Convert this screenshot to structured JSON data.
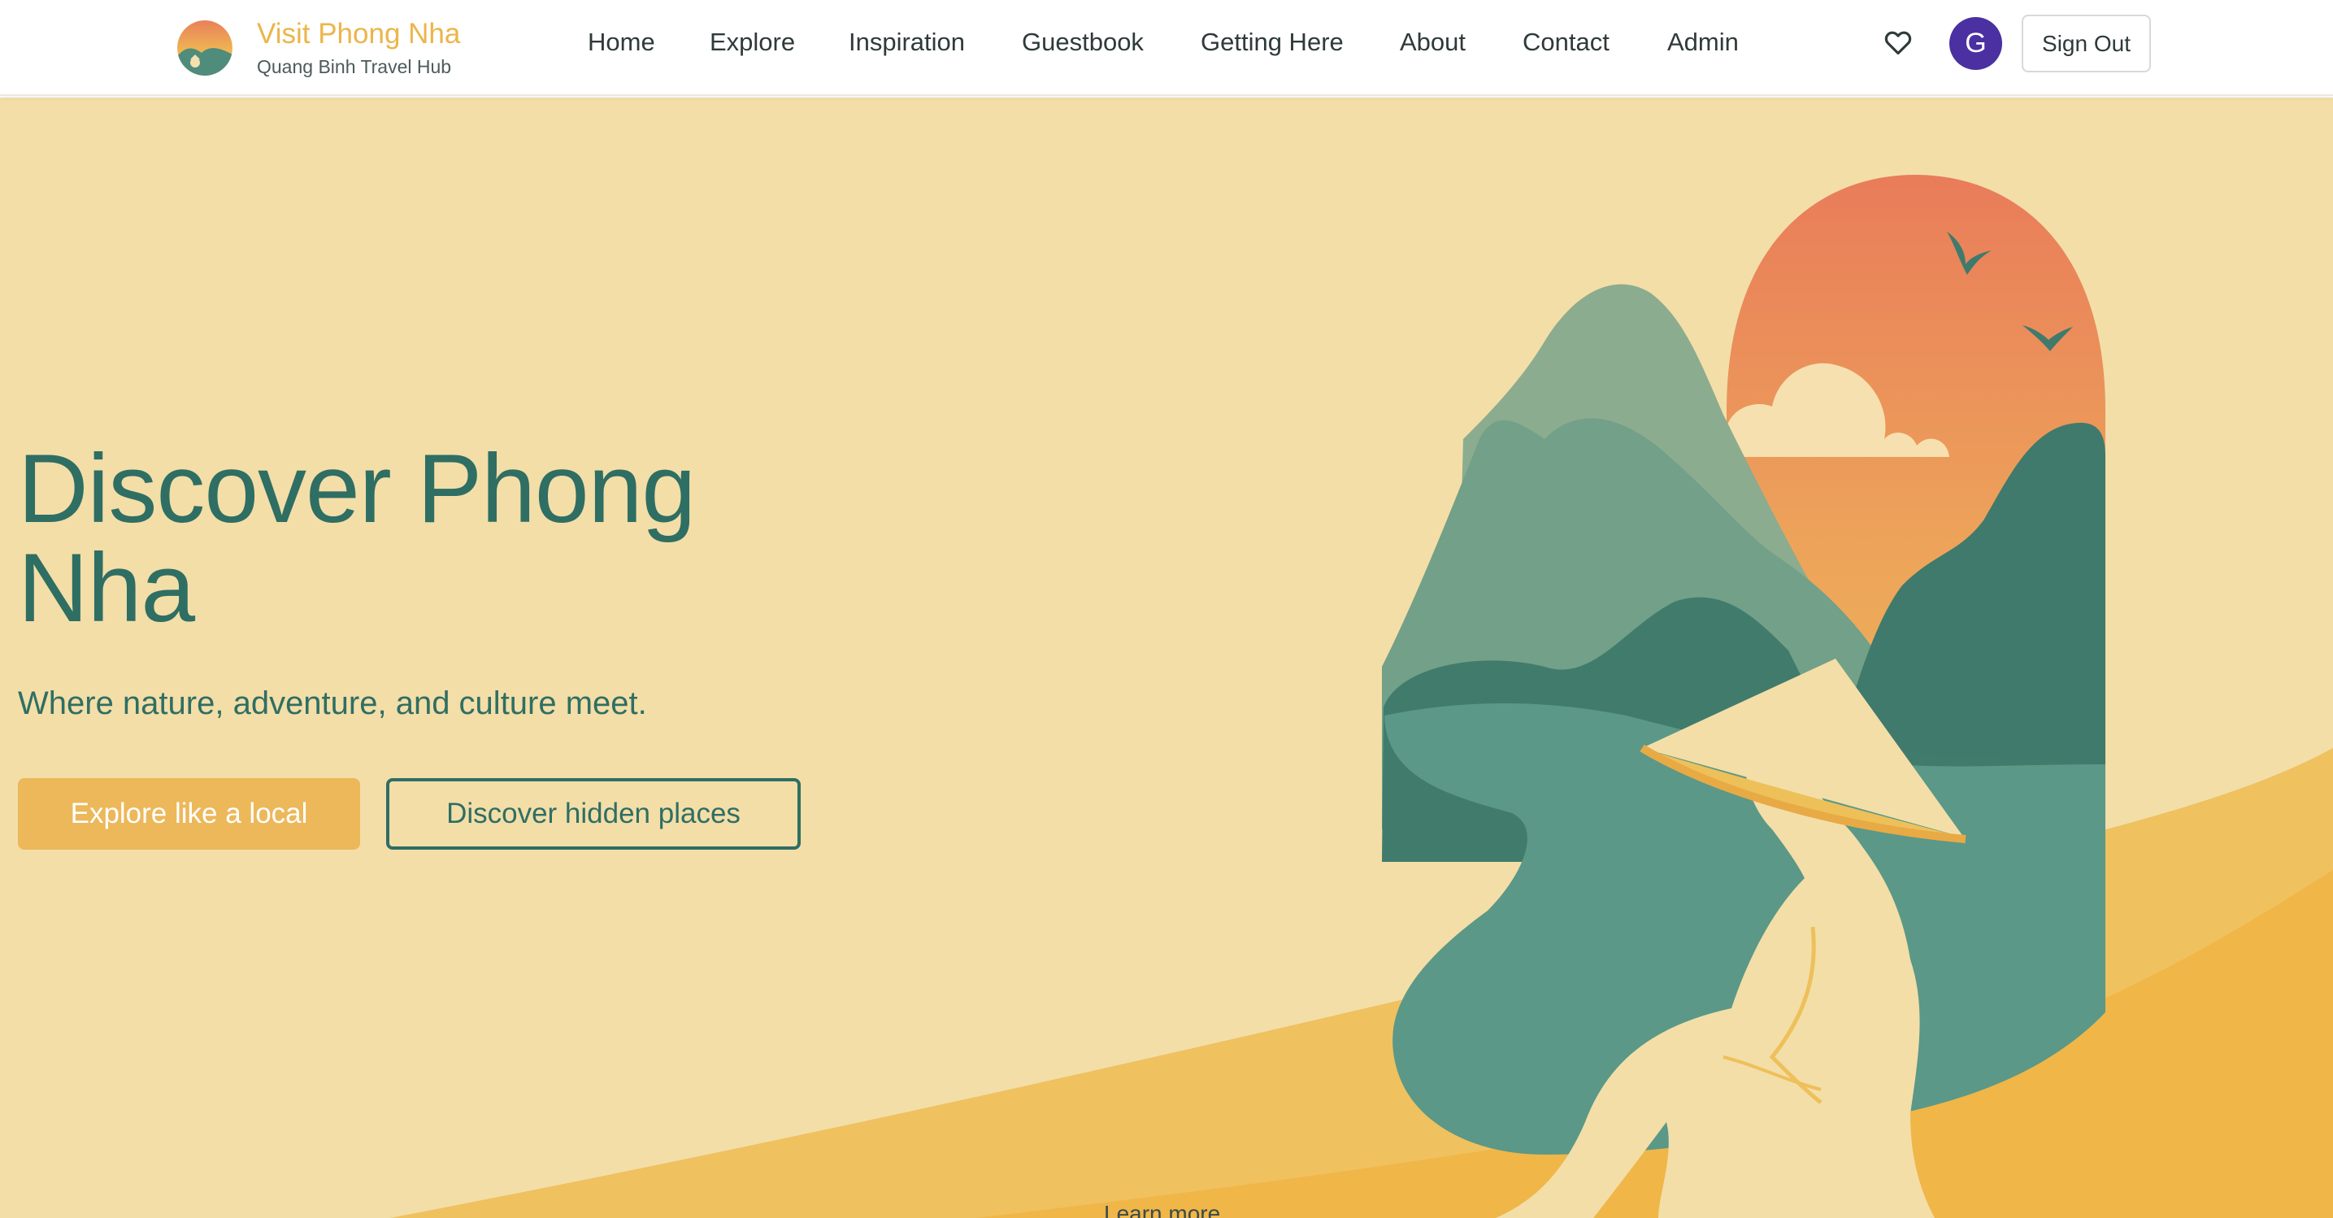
{
  "header": {
    "brand_title": "Visit Phong Nha",
    "brand_subtitle": "Quang Binh Travel Hub",
    "nav": [
      {
        "label": "Home"
      },
      {
        "label": "Explore"
      },
      {
        "label": "Inspiration"
      },
      {
        "label": "Guestbook"
      },
      {
        "label": "Getting Here"
      },
      {
        "label": "About"
      },
      {
        "label": "Contact"
      },
      {
        "label": "Admin"
      }
    ],
    "favorites_icon": "heart-icon",
    "avatar_initial": "G",
    "sign_out_label": "Sign Out"
  },
  "hero": {
    "title": "Discover Phong Nha",
    "subtitle": "Where nature, adventure, and culture meet.",
    "primary_cta": "Explore like a local",
    "secondary_cta": "Discover hidden places",
    "learn_more": "Learn more"
  },
  "colors": {
    "brand_gold": "#ecb54a",
    "hero_bg": "#f3dea8",
    "teal": "#2f6e63",
    "avatar": "#4a30a0"
  }
}
